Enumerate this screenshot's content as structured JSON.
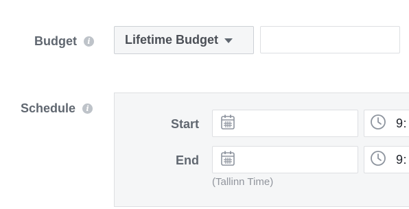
{
  "budget": {
    "label": "Budget",
    "info_icon": "info-icon",
    "type_selected": "Lifetime Budget",
    "amount_value": "",
    "amount_placeholder": ""
  },
  "schedule": {
    "label": "Schedule",
    "info_icon": "info-icon",
    "start": {
      "label": "Start",
      "date_value": "",
      "date_icon": "calendar-icon",
      "time_value": "9:",
      "time_icon": "clock-icon"
    },
    "end": {
      "label": "End",
      "date_value": "",
      "date_icon": "calendar-icon",
      "time_value": "9:",
      "time_icon": "clock-icon"
    },
    "timezone": "(Tallinn Time)"
  },
  "colors": {
    "label_text": "#606770",
    "panel_background": "#f5f6f7",
    "border": "#dddfe2",
    "muted_text": "#90949c"
  }
}
